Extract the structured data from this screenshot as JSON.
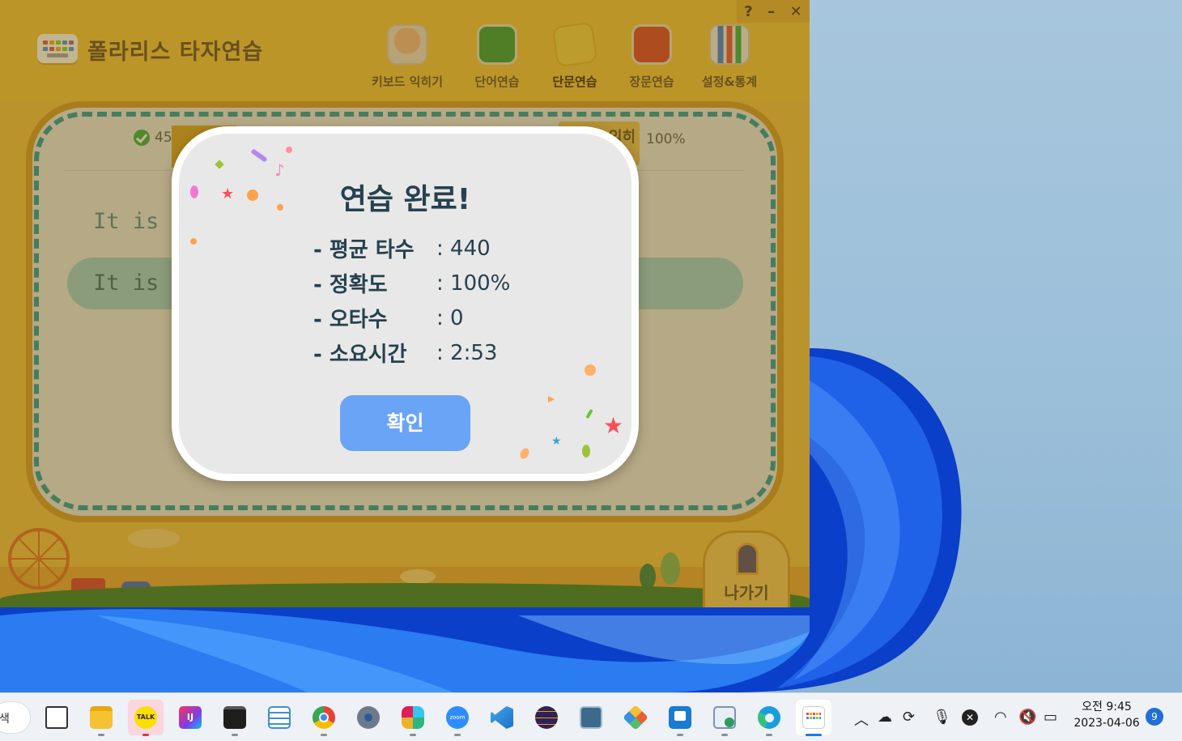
{
  "window": {
    "title": "폴라리스 타자연습",
    "help": "?",
    "minimize": "–",
    "close": "✕"
  },
  "nav": {
    "items": [
      {
        "label": "키보드 익히기",
        "icon": "hand-icon"
      },
      {
        "label": "단어연습",
        "icon": "green-book-icon"
      },
      {
        "label": "단문연습",
        "icon": "sticky-note-icon"
      },
      {
        "label": "장문연습",
        "icon": "red-notebook-icon"
      },
      {
        "label": "설정&통계",
        "icon": "bar-chart-gear-icon"
      }
    ],
    "active_index": 2
  },
  "practice": {
    "count_prefix": "45",
    "percent": "100%",
    "tab_fragment": "키보드 익히",
    "line1": "It is n",
    "line2": "It is n"
  },
  "exit": {
    "label": "나가기"
  },
  "dialog": {
    "title": "연습 완료!",
    "rows": [
      {
        "label": "- 평균 타수",
        "value": ": 440"
      },
      {
        "label": "- 정확도",
        "value": ": 100%"
      },
      {
        "label": "- 오타수",
        "value": ": 0"
      },
      {
        "label": "- 소요시간",
        "value": ": 2:53"
      }
    ],
    "confirm": "확인"
  },
  "taskbar": {
    "search_fragment": "색",
    "apps": [
      {
        "name": "task-view-icon",
        "color": "#3a3a3a"
      },
      {
        "name": "file-explorer-icon",
        "color": "#f4c233"
      },
      {
        "name": "kakaotalk-icon",
        "color": "#f9e000",
        "label": "TALK"
      },
      {
        "name": "intellij-icon",
        "color": "#7b3fe4",
        "label": "IJ"
      },
      {
        "name": "terminal-icon",
        "color": "#1e1e1e"
      },
      {
        "name": "notepad-icon",
        "color": "#3d8fd6"
      },
      {
        "name": "chrome-icon",
        "color": "#e94235"
      },
      {
        "name": "settings-icon",
        "color": "#6b7b8c"
      },
      {
        "name": "slack-icon",
        "color": "#e01e5a"
      },
      {
        "name": "zoom-icon",
        "color": "#2d8cff",
        "label": "zoom"
      },
      {
        "name": "vscode-icon",
        "color": "#1f8ad2"
      },
      {
        "name": "eclipse-icon",
        "color": "#2c2255"
      },
      {
        "name": "mysql-workbench-icon",
        "color": "#3d6a8a"
      },
      {
        "name": "sourcetree-icon",
        "color": "#e85d3a"
      },
      {
        "name": "app-store-icon",
        "color": "#1a7bd1"
      },
      {
        "name": "media-player-icon",
        "color": "#2e9b5f"
      },
      {
        "name": "edge-icon",
        "color": "#1a9de0"
      },
      {
        "name": "typing-practice-icon",
        "color": "#ffffff"
      }
    ],
    "clock_time": "오전 9:45",
    "clock_date": "2023-04-06",
    "notifications": "9"
  }
}
